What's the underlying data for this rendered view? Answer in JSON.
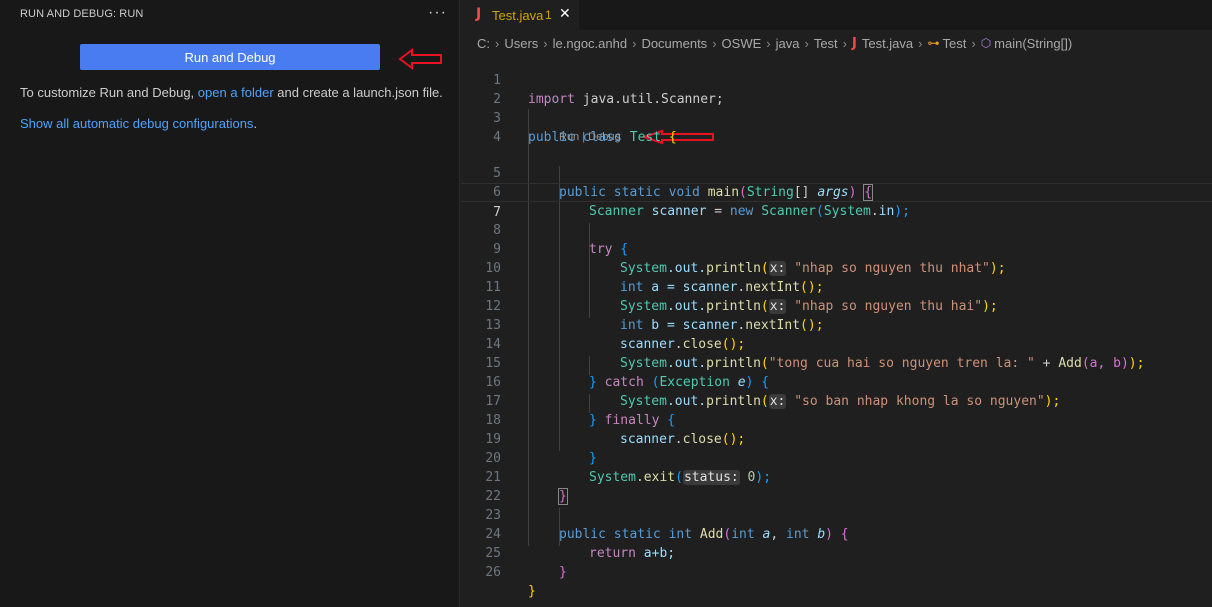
{
  "sidebar": {
    "title": "RUN AND DEBUG: RUN",
    "more_icon": "ellipsis-icon",
    "more_label": "···",
    "run_button_label": "Run and Debug",
    "description_prefix": "To customize Run and Debug, ",
    "description_link": "open a folder",
    "description_suffix": " and create a launch.json file.",
    "show_all_link": "Show all automatic debug configurations",
    "show_all_suffix": "."
  },
  "annotation": {
    "arrow_color": "#e81123"
  },
  "tab": {
    "icon_label": "J",
    "name": "Test.java",
    "problems": "1",
    "close_label": "✕"
  },
  "breadcrumb": {
    "parts": [
      "C:",
      "Users",
      "le.ngoc.anhd",
      "Documents",
      "OSWE",
      "java",
      "Test"
    ],
    "file_icon": "J",
    "file": "Test.java",
    "class_icon": "⊶",
    "class": "Test",
    "method_icon": "⬡",
    "method": "main(String[])",
    "separator": "›"
  },
  "codelens": {
    "run": "Run",
    "divider": " | ",
    "debug": "Debug"
  },
  "editor": {
    "active_line": "6",
    "line_numbers": [
      "1",
      "2",
      "3",
      "4",
      "5",
      "6",
      "7",
      "8",
      "9",
      "10",
      "11",
      "12",
      "13",
      "14",
      "15",
      "16",
      "17",
      "18",
      "19",
      "20",
      "21",
      "22",
      "23",
      "24",
      "25",
      "26"
    ]
  },
  "code": {
    "l1_kw": "import",
    "l1_rest": " java.util.Scanner;",
    "l3_kw": "public",
    "l3_kw2": " class ",
    "l3_name": "Test",
    "l3_brace": " {",
    "l5_kw": "public static void ",
    "l5_fn": "main",
    "l5_p": "(",
    "l5_ty": "String",
    "l5_arr": "[] ",
    "l5_arg": "args",
    "l5_end": ") ",
    "l5_brace": "{",
    "l6_ty": "Scanner",
    "l6_sp": " ",
    "l6_var": "scanner",
    "l6_eq": " = ",
    "l6_new": "new ",
    "l6_ty2": "Scanner",
    "l6_p": "(",
    "l6_sys": "System",
    "l6_dot": ".",
    "l6_in": "in",
    "l6_end": ");",
    "l8_kw": "try",
    "l8_brace": " {",
    "l9_sys": "System",
    "l9_out": ".out.",
    "l9_fn": "println",
    "l9_p": "(",
    "l9_hint": "x:",
    "l9_str": " \"nhap so nguyen thu nhat\"",
    "l9_end": ");",
    "l10_kw": "int",
    "l10_rest": " a = ",
    "l10_var": "scanner",
    "l10_dot": ".",
    "l10_fn": "nextInt",
    "l10_end": "();",
    "l11_sys": "System",
    "l11_out": ".out.",
    "l11_fn": "println",
    "l11_p": "(",
    "l11_hint": "x:",
    "l11_str": " \"nhap so nguyen thu hai\"",
    "l11_end": ");",
    "l12_kw": "int",
    "l12_rest": " b = ",
    "l12_var": "scanner",
    "l12_dot": ".",
    "l12_fn": "nextInt",
    "l12_end": "();",
    "l13_var": "scanner",
    "l13_dot": ".",
    "l13_fn": "close",
    "l13_end": "();",
    "l14_sys": "System",
    "l14_out": ".out.",
    "l14_fn": "println",
    "l14_p": "(",
    "l14_str": "\"tong cua hai so nguyen tren la: \"",
    "l14_plus": " + ",
    "l14_fn2": "Add",
    "l14_args": "(a, b)",
    "l14_end": ");",
    "l15_brace": "} ",
    "l15_kw": "catch",
    "l15_p": " (",
    "l15_ty": "Exception",
    "l15_sp": " ",
    "l15_e": "e",
    "l15_end": ") ",
    "l15_brace2": "{",
    "l16_sys": "System",
    "l16_out": ".out.",
    "l16_fn": "println",
    "l16_p": "(",
    "l16_hint": "x:",
    "l16_str": " \"so ban nhap khong la so nguyen\"",
    "l16_end": ");",
    "l17_brace": "} ",
    "l17_kw": "finally",
    "l17_brace2": " {",
    "l18_var": "scanner",
    "l18_dot": ".",
    "l18_fn": "close",
    "l18_end": "();",
    "l19_brace": "}",
    "l20_sys": "System",
    "l20_dot": ".",
    "l20_fn": "exit",
    "l20_p": "(",
    "l20_hint": "status:",
    "l20_num": " 0",
    "l20_end": ");",
    "l21_brace": "}",
    "l23_kw": "public static ",
    "l23_int": "int ",
    "l23_fn": "Add",
    "l23_p": "(",
    "l23_int2": "int ",
    "l23_a": "a",
    "l23_c": ", ",
    "l23_int3": "int ",
    "l23_b": "b",
    "l23_end": ") ",
    "l23_brace": "{",
    "l24_kw": "return",
    "l24_rest": " a+b;",
    "l25_brace": "}",
    "l26_brace": "}"
  }
}
